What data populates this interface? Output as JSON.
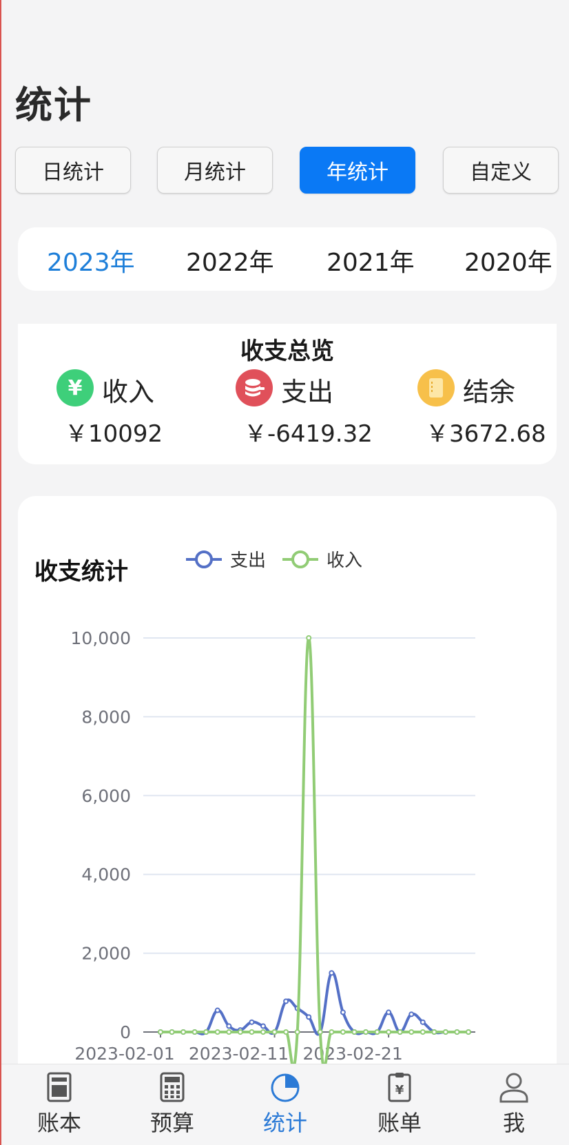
{
  "header": {
    "title": "统计"
  },
  "segments": [
    {
      "label": "日统计",
      "active": false
    },
    {
      "label": "月统计",
      "active": false
    },
    {
      "label": "年统计",
      "active": true
    },
    {
      "label": "自定义",
      "active": false
    }
  ],
  "years": [
    {
      "label": "2023年",
      "active": true
    },
    {
      "label": "2022年",
      "active": false
    },
    {
      "label": "2021年",
      "active": false
    },
    {
      "label": "2020年",
      "active": false
    }
  ],
  "overview": {
    "title": "收支总览",
    "income": {
      "label": "收入",
      "value": "￥10092",
      "icon": "yen-icon",
      "color": "#3ecf7a"
    },
    "expense": {
      "label": "支出",
      "value": "￥-6419.32",
      "icon": "coins-icon",
      "color": "#e0505a"
    },
    "balance": {
      "label": "结余",
      "value": "￥3672.68",
      "icon": "notebook-icon",
      "color": "#f7c04a"
    }
  },
  "chart_data": {
    "type": "line",
    "title": "收支统计",
    "legend_position": "top-center",
    "grid": true,
    "ylim": [
      0,
      10000
    ],
    "yticks": [
      "10,000",
      "8,000",
      "6,000",
      "4,000",
      "2,000",
      "0"
    ],
    "xticks": [
      "2023-02-01",
      "2023-02-11",
      "2023-02-21"
    ],
    "x": [
      "2023-02-01",
      "2023-02-02",
      "2023-02-03",
      "2023-02-04",
      "2023-02-05",
      "2023-02-06",
      "2023-02-07",
      "2023-02-08",
      "2023-02-09",
      "2023-02-10",
      "2023-02-11",
      "2023-02-12",
      "2023-02-13",
      "2023-02-14",
      "2023-02-15",
      "2023-02-16",
      "2023-02-17",
      "2023-02-18",
      "2023-02-19",
      "2023-02-20",
      "2023-02-21",
      "2023-02-22",
      "2023-02-23",
      "2023-02-24",
      "2023-02-25",
      "2023-02-26",
      "2023-02-27",
      "2023-02-28"
    ],
    "series": [
      {
        "name": "支出",
        "color": "#5470c6",
        "values": [
          0,
          0,
          0,
          0,
          0,
          550,
          150,
          50,
          250,
          150,
          0,
          780,
          600,
          380,
          0,
          1500,
          500,
          0,
          0,
          0,
          500,
          0,
          450,
          250,
          0,
          0,
          0,
          0
        ]
      },
      {
        "name": "收入",
        "color": "#91cc75",
        "values": [
          0,
          0,
          0,
          0,
          0,
          0,
          0,
          0,
          0,
          0,
          0,
          0,
          0,
          10000,
          0,
          0,
          0,
          0,
          0,
          0,
          0,
          0,
          0,
          0,
          0,
          0,
          0,
          0
        ]
      }
    ]
  },
  "tabs": [
    {
      "label": "账本",
      "icon": "ledger-icon",
      "active": false
    },
    {
      "label": "预算",
      "icon": "calculator-icon",
      "active": false
    },
    {
      "label": "统计",
      "icon": "pie-chart-icon",
      "active": true
    },
    {
      "label": "账单",
      "icon": "bill-icon",
      "active": false
    },
    {
      "label": "我",
      "icon": "user-icon",
      "active": false
    }
  ]
}
